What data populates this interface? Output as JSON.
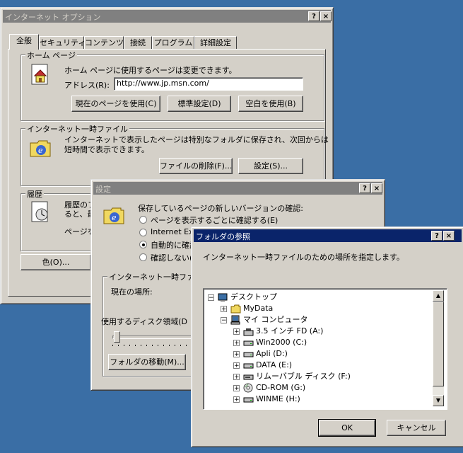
{
  "main": {
    "title": "インターネット オプション",
    "help": "?",
    "close": "×",
    "tabs": [
      "全般",
      "セキュリティ",
      "コンテンツ",
      "接続",
      "プログラム",
      "詳細設定"
    ],
    "home": {
      "group": "ホーム ページ",
      "desc": "ホーム ページに使用するページは変更できます。",
      "address_label": "アドレス(R):",
      "address_value": "http://www.jp.msn.com/",
      "btn_current": "現在のページを使用(C)",
      "btn_default": "標準設定(D)",
      "btn_blank": "空白を使用(B)"
    },
    "temp": {
      "group": "インターネット一時ファイル",
      "desc1": "インターネットで表示したページは特別なフォルダに保存され、次回からは",
      "desc2": "短時間で表示できます。",
      "btn_delete": "ファイルの削除(F)...",
      "btn_settings": "設定(S)..."
    },
    "history": {
      "group": "履歴",
      "desc1": "履歴のフ",
      "desc2": "ると、最",
      "desc3": "ページを"
    },
    "btn_colors": "色(O)..."
  },
  "settings": {
    "title": "設定",
    "help": "?",
    "close": "×",
    "check_label": "保存しているページの新しいバージョンの確認:",
    "options": [
      "ページを表示するごとに確認する(E)",
      "Internet Exp",
      "自動的に確認",
      "確認しない(N"
    ],
    "selected_option": 2,
    "temp_group": "インターネット一時ファイル",
    "current_location": "現在の場所:",
    "disk_usage": "使用するディスク領域(D",
    "btn_move": "フォルダの移動(M)..."
  },
  "browse": {
    "title": "フォルダの参照",
    "help": "?",
    "close": "×",
    "prompt": "インターネット一時ファイルのための場所を指定します。",
    "tree": [
      {
        "label": "デスクトップ",
        "icon": "desktop-icon",
        "level": 0,
        "pm": "−"
      },
      {
        "label": "MyData",
        "icon": "folder-icon",
        "level": 1,
        "pm": "+"
      },
      {
        "label": "マイ コンピュータ",
        "icon": "computer-icon",
        "level": 1,
        "pm": "−"
      },
      {
        "label": "3.5 インチ FD (A:)",
        "icon": "floppy-icon",
        "level": 2,
        "pm": "+"
      },
      {
        "label": "Win2000 (C:)",
        "icon": "drive-icon",
        "level": 2,
        "pm": "+"
      },
      {
        "label": "Apli (D:)",
        "icon": "drive-icon",
        "level": 2,
        "pm": "+"
      },
      {
        "label": "DATA (E:)",
        "icon": "drive-icon",
        "level": 2,
        "pm": "+"
      },
      {
        "label": "リムーバブル ディスク (F:)",
        "icon": "removable-drive-icon",
        "level": 2,
        "pm": "+"
      },
      {
        "label": "CD-ROM (G:)",
        "icon": "cdrom-icon",
        "level": 2,
        "pm": "+"
      },
      {
        "label": "WINME (H:)",
        "icon": "drive-icon",
        "level": 2,
        "pm": "+"
      }
    ],
    "btn_ok": "OK",
    "btn_cancel": "キャンセル"
  }
}
